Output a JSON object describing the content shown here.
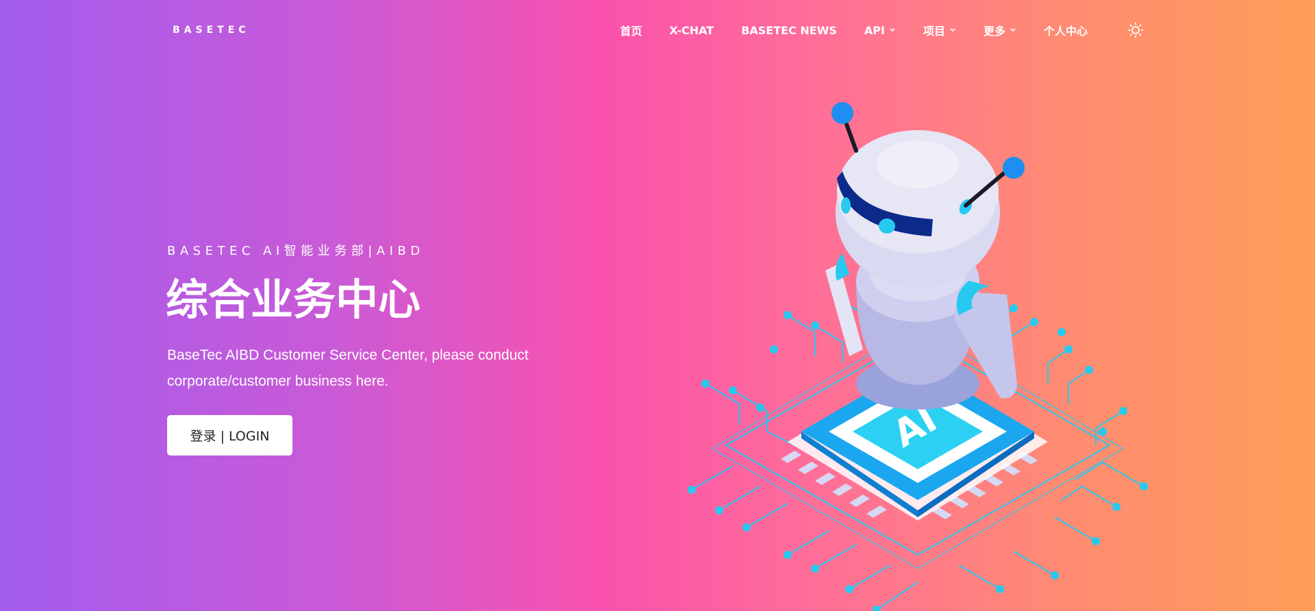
{
  "header": {
    "logo_text": "BASETEC",
    "nav": [
      {
        "label": "首页",
        "has_dropdown": false
      },
      {
        "label": "X-CHAT",
        "has_dropdown": false
      },
      {
        "label": "BASETEC NEWS",
        "has_dropdown": false
      },
      {
        "label": "API",
        "has_dropdown": true
      },
      {
        "label": "项目",
        "has_dropdown": true
      },
      {
        "label": "更多",
        "has_dropdown": true
      },
      {
        "label": "个人中心",
        "has_dropdown": false
      }
    ],
    "theme_icon": "sun-icon",
    "chevron_glyph": "⌄"
  },
  "hero": {
    "eyebrow": "BASETEC AI智能业务部|AIBD",
    "title": "综合业务中心",
    "subtitle": "BaseTec AIBD Customer Service Center, please conduct corporate/customer business here.",
    "login_label": "登录 | LOGIN",
    "chip_label": "AI"
  },
  "colors": {
    "gradient_left": "#a25cee",
    "gradient_mid": "#fa52ad",
    "gradient_right": "#ff9e57",
    "circuit_cyan": "#27c9ee",
    "antenna_blue": "#1e8ff0",
    "visor_navy": "#0b2a8a"
  }
}
